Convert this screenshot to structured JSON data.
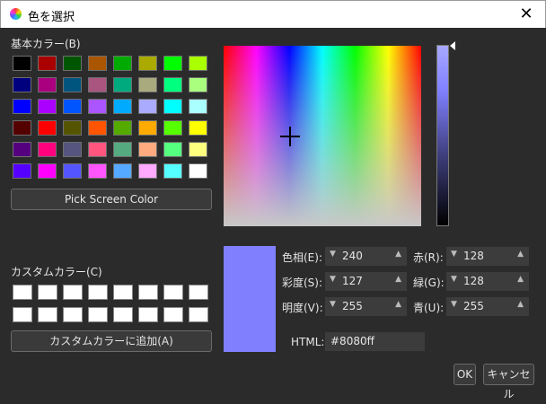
{
  "title": "色を選択",
  "basic_label": "基本カラー(B)",
  "custom_label": "カスタムカラー(C)",
  "pick_button": "Pick Screen Color",
  "add_custom_button": "カスタムカラーに追加(A)",
  "basic_colors": [
    [
      "#000000",
      "#aa0000",
      "#005500",
      "#aa5500",
      "#00aa00",
      "#aaaa00",
      "#00ff00",
      "#aaff00"
    ],
    [
      "#00007f",
      "#aa007f",
      "#00557f",
      "#aa557f",
      "#00aa7f",
      "#aaaa7f",
      "#00ff7f",
      "#aaff7f"
    ],
    [
      "#0000ff",
      "#aa00ff",
      "#0055ff",
      "#aa55ff",
      "#00aaff",
      "#aaaaff",
      "#00ffff",
      "#aaffff"
    ],
    [
      "#550000",
      "#ff0000",
      "#555500",
      "#ff5500",
      "#55aa00",
      "#ffaa00",
      "#55ff00",
      "#ffff00"
    ],
    [
      "#55007f",
      "#ff007f",
      "#55557f",
      "#ff557f",
      "#55aa7f",
      "#ffaa7f",
      "#55ff7f",
      "#ffff7f"
    ],
    [
      "#5500ff",
      "#ff00ff",
      "#5555ff",
      "#ff55ff",
      "#55aaff",
      "#ffaaff",
      "#55ffff",
      "#ffffff"
    ]
  ],
  "custom_colors": [
    "#ffffff",
    "#ffffff",
    "#ffffff",
    "#ffffff",
    "#ffffff",
    "#ffffff",
    "#ffffff",
    "#ffffff",
    "#ffffff",
    "#ffffff",
    "#ffffff",
    "#ffffff",
    "#ffffff",
    "#ffffff",
    "#ffffff",
    "#ffffff"
  ],
  "fields": {
    "hue": {
      "label": "色相(E):",
      "value": "240"
    },
    "sat": {
      "label": "彩度(S):",
      "value": "127"
    },
    "val": {
      "label": "明度(V):",
      "value": "255"
    },
    "red": {
      "label": "赤(R):",
      "value": "128"
    },
    "green": {
      "label": "緑(G):",
      "value": "128"
    },
    "blue": {
      "label": "青(U):",
      "value": "255"
    }
  },
  "html_label": "HTML:",
  "html_value": "#8080ff",
  "current_color": "#8080ff",
  "ok": "OK",
  "cancel": "キャンセル",
  "icons": {
    "close": "close-icon",
    "spin_down": "▼",
    "spin_up": "▲"
  }
}
